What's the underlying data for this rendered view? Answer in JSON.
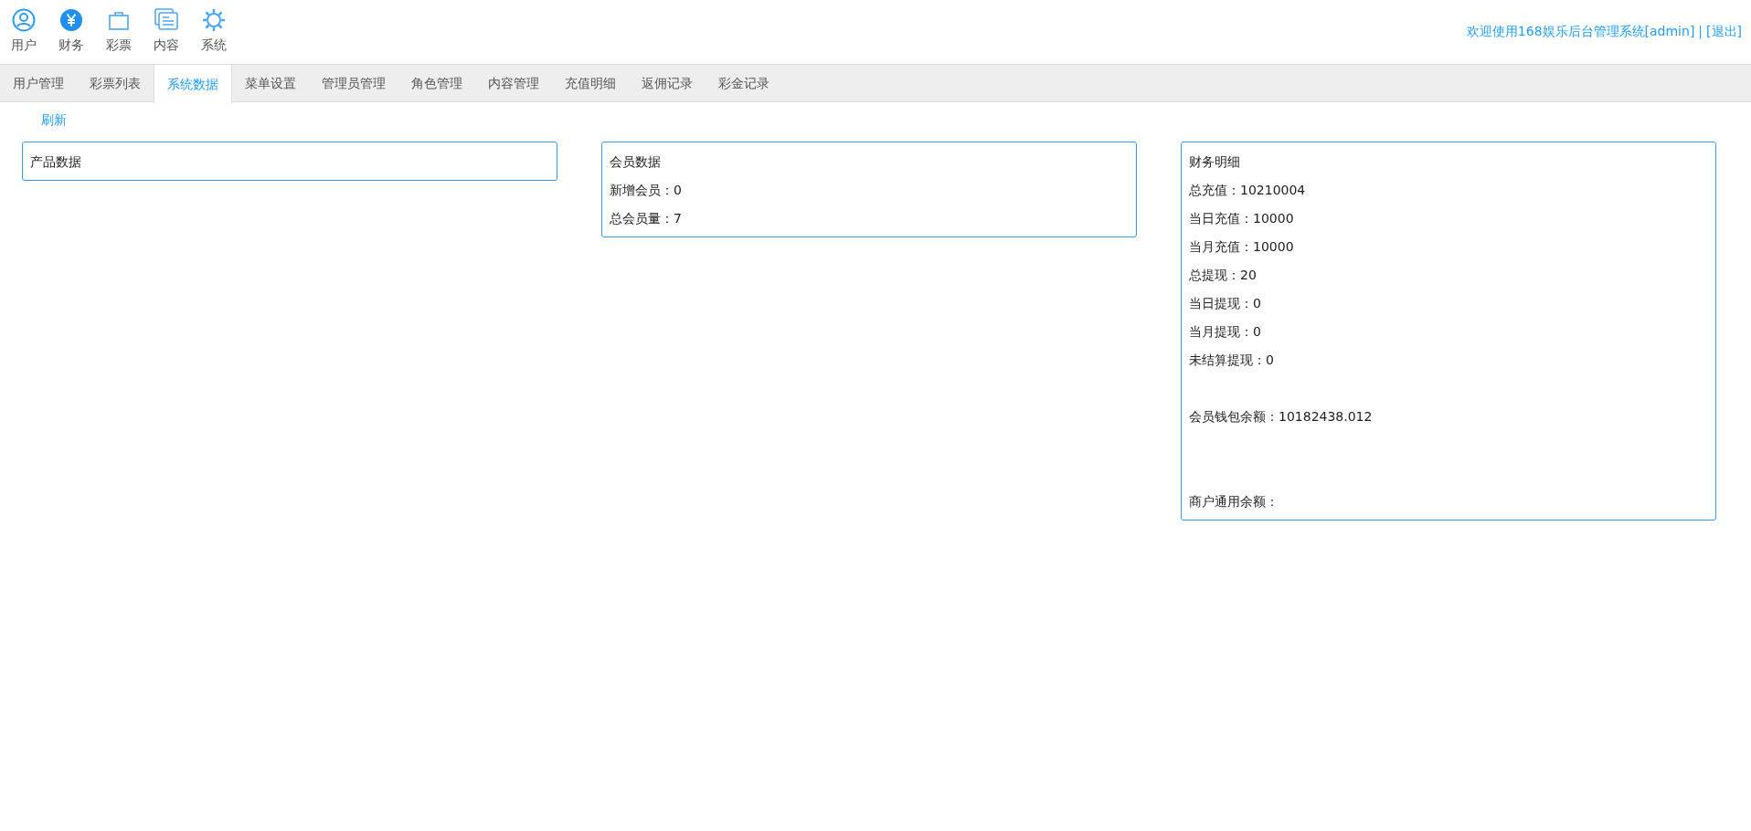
{
  "top_nav": [
    {
      "label": "用户",
      "kind": "user"
    },
    {
      "label": "财务",
      "kind": "finance"
    },
    {
      "label": "彩票",
      "kind": "bag"
    },
    {
      "label": "内容",
      "kind": "content"
    },
    {
      "label": "系统",
      "kind": "system"
    }
  ],
  "welcome": {
    "text": "欢迎使用168娱乐后台管理系统[admin]",
    "separator": "|",
    "logout": "[退出]"
  },
  "tabs": [
    {
      "label": "用户管理",
      "selected": false
    },
    {
      "label": "彩票列表",
      "selected": false
    },
    {
      "label": "系统数据",
      "selected": true
    },
    {
      "label": "菜单设置",
      "selected": false
    },
    {
      "label": "管理员管理",
      "selected": false
    },
    {
      "label": "角色管理",
      "selected": false
    },
    {
      "label": "内容管理",
      "selected": false
    },
    {
      "label": "充值明细",
      "selected": false
    },
    {
      "label": "返佣记录",
      "selected": false
    },
    {
      "label": "彩金记录",
      "selected": false
    }
  ],
  "refresh": "刷新",
  "panels": [
    {
      "title": "产品数据"
    },
    {
      "title": "会员数据",
      "sections": [
        [
          {
            "label": "新增会员：",
            "value": "0"
          },
          {
            "label": "总会员量：",
            "value": "7"
          }
        ]
      ]
    },
    {
      "title": "财务明细",
      "sections": [
        [
          {
            "label": "总充值：",
            "value": "10210004"
          },
          {
            "label": "当日充值：",
            "value": "10000"
          },
          {
            "label": "当月充值：",
            "value": "10000"
          },
          {
            "label": "总提现：",
            "value": "20"
          },
          {
            "label": "当日提现：",
            "value": "0"
          },
          {
            "label": "当月提现：",
            "value": "0"
          },
          {
            "label": "未结算提现：",
            "value": "0"
          }
        ],
        [
          {
            "label": "会员钱包余额：",
            "value": "10182438.012"
          }
        ],
        [
          {
            "label": "商户通用余额："
          }
        ]
      ]
    }
  ]
}
